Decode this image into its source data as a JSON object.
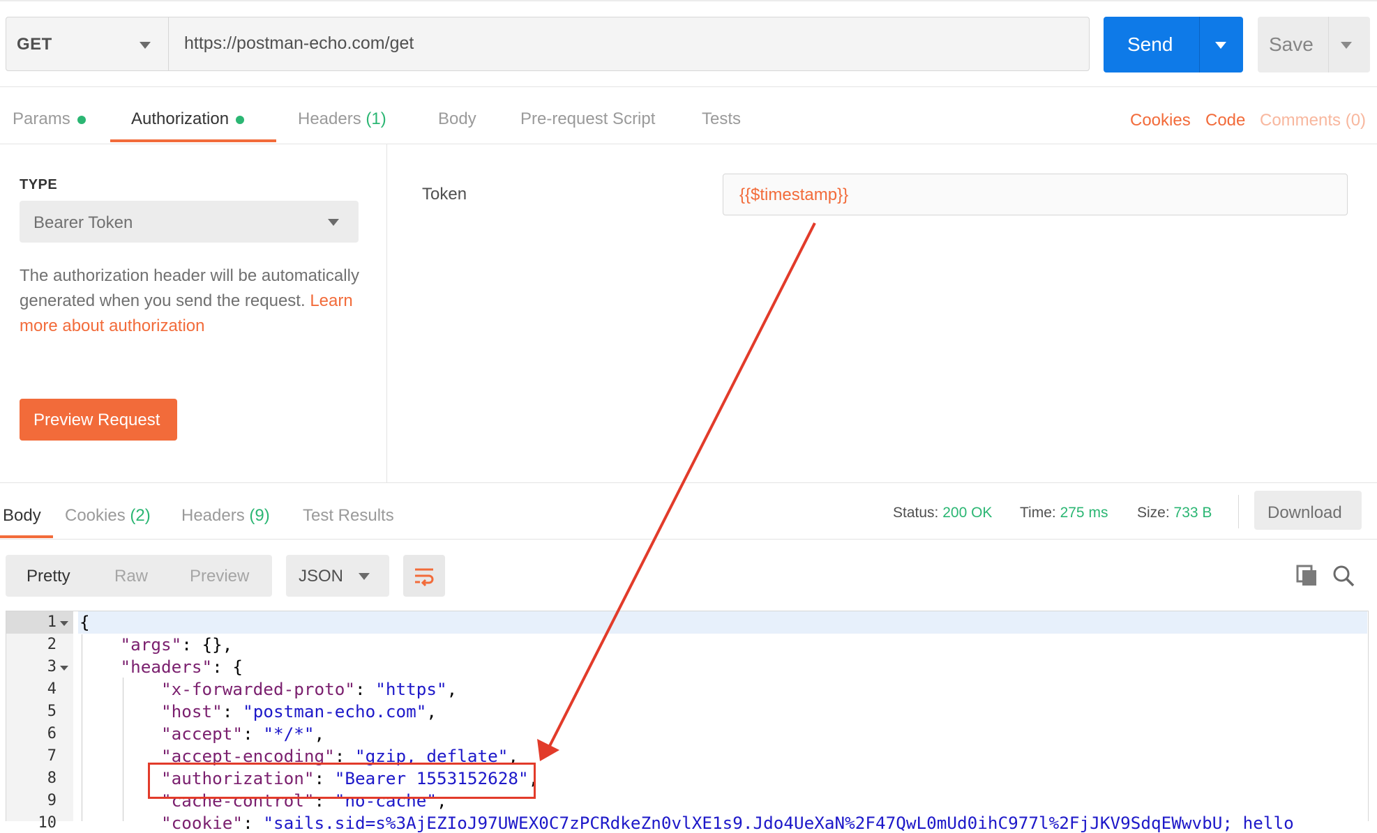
{
  "request": {
    "method": "GET",
    "url": "https://postman-echo.com/get",
    "send_label": "Send",
    "save_label": "Save"
  },
  "tabs": {
    "params": "Params",
    "authorization": "Authorization",
    "headers": "Headers",
    "headers_count": "(1)",
    "body": "Body",
    "prerequest": "Pre-request Script",
    "tests": "Tests"
  },
  "right_links": {
    "cookies": "Cookies",
    "code": "Code",
    "comments": "Comments (0)"
  },
  "auth": {
    "type_label": "TYPE",
    "type_value": "Bearer Token",
    "description": "The authorization header will be automatically generated when you send the request.",
    "learn_more": "Learn more about authorization",
    "preview_button": "Preview Request",
    "token_label": "Token",
    "token_value": "{{$timestamp}}"
  },
  "response_tabs": {
    "body": "Body",
    "cookies": "Cookies",
    "cookies_count": "(2)",
    "headers": "Headers",
    "headers_count": "(9)",
    "test_results": "Test Results"
  },
  "status": {
    "status_label": "Status:",
    "status_value": "200 OK",
    "time_label": "Time:",
    "time_value": "275 ms",
    "size_label": "Size:",
    "size_value": "733 B",
    "download_label": "Download"
  },
  "view": {
    "pretty": "Pretty",
    "raw": "Raw",
    "preview": "Preview",
    "format": "JSON"
  },
  "code": {
    "line_numbers": [
      "1",
      "2",
      "3",
      "4",
      "5",
      "6",
      "7",
      "8",
      "9",
      "10"
    ],
    "lines": [
      {
        "pre": "{",
        "key": "",
        "mid": "",
        "val": "",
        "post": ""
      },
      {
        "pre": "    ",
        "key": "\"args\"",
        "mid": ": {},",
        "val": "",
        "post": ""
      },
      {
        "pre": "    ",
        "key": "\"headers\"",
        "mid": ": {",
        "val": "",
        "post": ""
      },
      {
        "pre": "        ",
        "key": "\"x-forwarded-proto\"",
        "mid": ": ",
        "val": "\"https\"",
        "post": ","
      },
      {
        "pre": "        ",
        "key": "\"host\"",
        "mid": ": ",
        "val": "\"postman-echo.com\"",
        "post": ","
      },
      {
        "pre": "        ",
        "key": "\"accept\"",
        "mid": ": ",
        "val": "\"*/*\"",
        "post": ","
      },
      {
        "pre": "        ",
        "key": "\"accept-encoding\"",
        "mid": ": ",
        "val": "\"gzip, deflate\"",
        "post": ","
      },
      {
        "pre": "        ",
        "key": "\"authorization\"",
        "mid": ": ",
        "val": "\"Bearer 1553152628\"",
        "post": ","
      },
      {
        "pre": "        ",
        "key": "\"cache-control\"",
        "mid": ": ",
        "val": "\"no-cache\"",
        "post": ","
      },
      {
        "pre": "        ",
        "key": "\"cookie\"",
        "mid": ": ",
        "val": "\"sails.sid=s%3AjEZIoJ97UWEX0C7zPCRdkeZn0vlXE1s9.Jdo4UeXaN%2F47QwL0mUd0ihC977l%2FjJKV9SdqEWwvbU; hello",
        "post": ""
      }
    ]
  },
  "colors": {
    "accent": "#f26b3a",
    "send_blue": "#0e7ae8",
    "success_green": "#2bb673",
    "annotation_red": "#e23b2a"
  }
}
